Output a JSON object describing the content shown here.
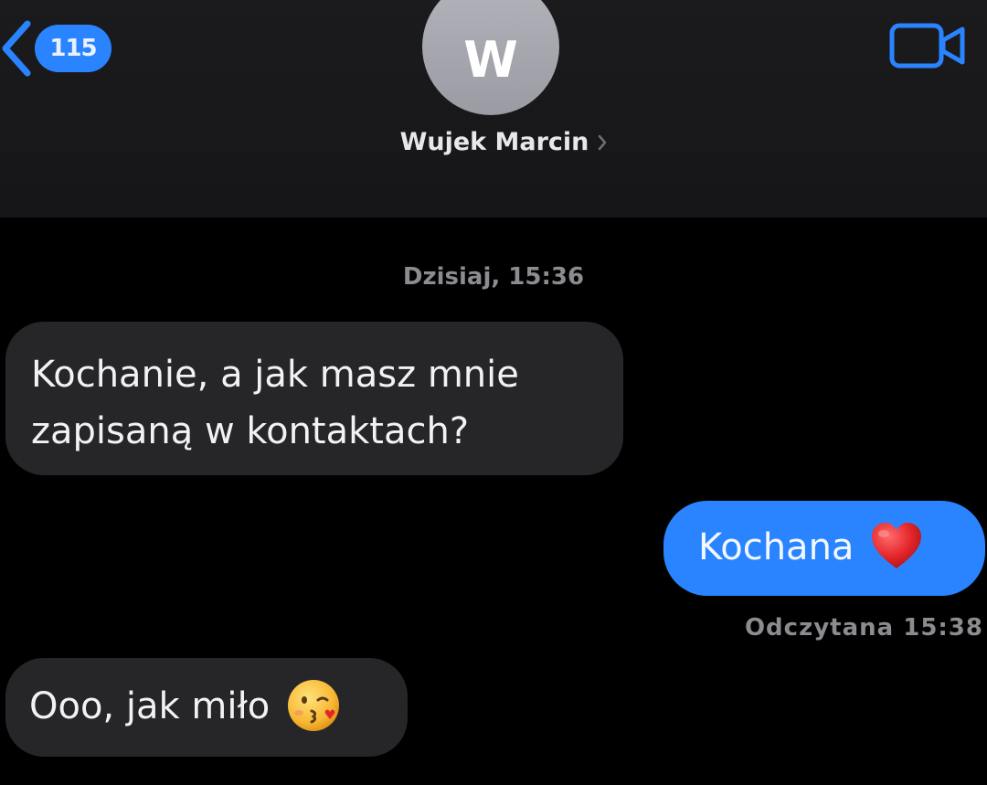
{
  "header": {
    "unread_count": "115",
    "avatar_initial": "W",
    "contact_name": "Wujek Marcin"
  },
  "conversation": {
    "timestamp": "Dzisiaj, 15:36",
    "messages": [
      {
        "direction": "incoming",
        "lines": [
          "Kochanie, a jak masz mnie",
          "zapisaną w kontaktach?"
        ]
      },
      {
        "direction": "outgoing",
        "text": "Kochana",
        "emoji": "red-heart"
      },
      {
        "direction": "incoming",
        "text": "Ooo, jak miło",
        "emoji": "kissing-face"
      }
    ],
    "read_receipt": "Odczytana 15:38"
  },
  "colors": {
    "accent_blue": "#2a84ff",
    "incoming_bubble": "#262629",
    "header_bg": "#1b1b1d",
    "background": "#000000"
  }
}
